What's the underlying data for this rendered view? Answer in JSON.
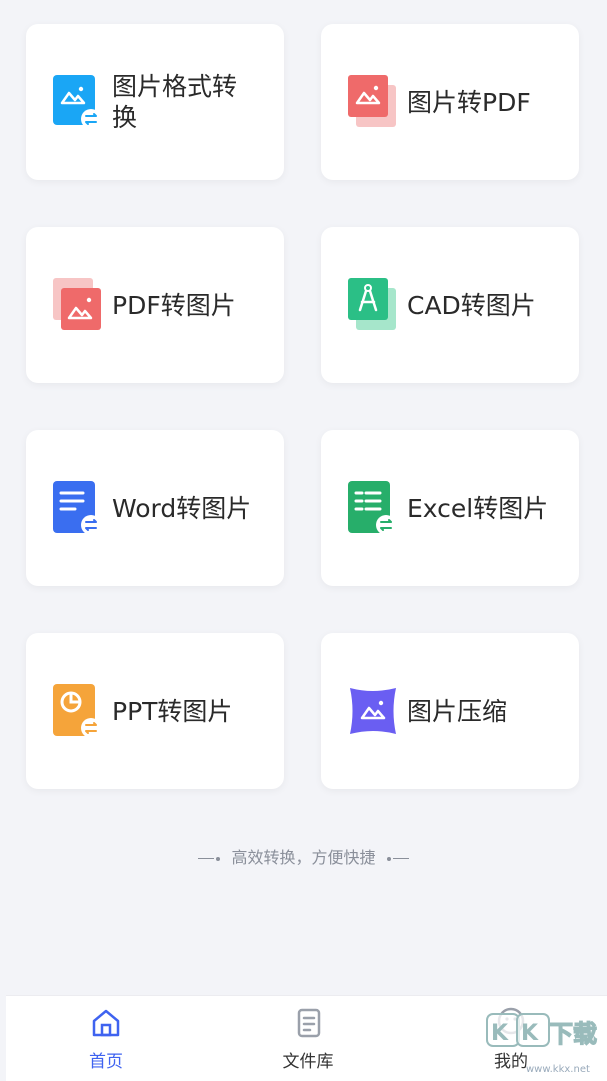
{
  "cards": [
    {
      "label": "图片格式转换",
      "icon": "image-format-convert-icon",
      "color": "#1aa6f5"
    },
    {
      "label": "图片转PDF",
      "icon": "image-to-pdf-icon",
      "color": "#ef6a6a"
    },
    {
      "label": "PDF转图片",
      "icon": "pdf-to-image-icon",
      "color": "#ef6a6a"
    },
    {
      "label": "CAD转图片",
      "icon": "cad-to-image-icon",
      "color": "#2bbf86"
    },
    {
      "label": "Word转图片",
      "icon": "word-to-image-icon",
      "color": "#3a6ef0"
    },
    {
      "label": "Excel转图片",
      "icon": "excel-to-image-icon",
      "color": "#27ae6a"
    },
    {
      "label": "PPT转图片",
      "icon": "ppt-to-image-icon",
      "color": "#f5a43a"
    },
    {
      "label": "图片压缩",
      "icon": "image-compress-icon",
      "color": "#6a5ef2"
    }
  ],
  "tagline": "高效转换，方便快捷",
  "tabs": [
    {
      "label": "首页",
      "icon": "home-icon",
      "active": true
    },
    {
      "label": "文件库",
      "icon": "file-library-icon",
      "active": false
    },
    {
      "label": "我的",
      "icon": "profile-icon",
      "active": false
    }
  ],
  "watermark": {
    "text": "KK下载",
    "url": "www.kkx.net"
  },
  "colors": {
    "accent": "#3f63f0",
    "background": "#f3f4f8"
  }
}
